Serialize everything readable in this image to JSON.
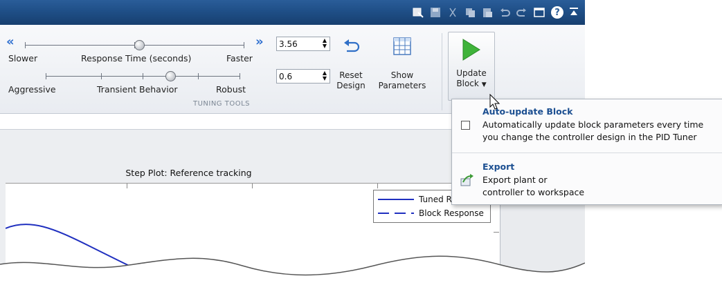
{
  "toolstrip": {
    "group_label": "TUNING TOOLS",
    "response_slider": {
      "left_label": "Slower",
      "center_label": "Response Time (seconds)",
      "right_label": "Faster",
      "value": "3.56"
    },
    "transient_slider": {
      "left_label": "Aggressive",
      "center_label": "Transient Behavior",
      "right_label": "Robust",
      "value": "0.6"
    },
    "reset": {
      "line1": "Reset",
      "line2": "Design"
    },
    "show": {
      "line1": "Show",
      "line2": "Parameters"
    },
    "update": {
      "line1": "Update",
      "line2": "Block"
    }
  },
  "quick_access": [
    "block-icon",
    "save-icon",
    "cut-icon",
    "copy-icon",
    "paste-icon",
    "undo-icon",
    "redo-icon",
    "window-icon",
    "help-icon",
    "collapse-icon"
  ],
  "plot": {
    "title": "Step Plot: Reference tracking",
    "legend": [
      {
        "label": "Tuned R",
        "style": "solid",
        "color": "#1f2fbf"
      },
      {
        "label": "Block Response",
        "style": "dashed",
        "color": "#1f2fbf"
      }
    ]
  },
  "menu": {
    "auto_update": {
      "title": "Auto-update Block",
      "desc_line1": "Automatically update block parameters every time",
      "desc_line2": "you  change the controller design in the PID Tuner",
      "checked": false
    },
    "export": {
      "title": "Export",
      "desc_line1": "Export plant or",
      "desc_line2": "controller to workspace"
    }
  },
  "colors": {
    "titlebar": "#1f4f87",
    "accent": "#1c4f91",
    "curve": "#1f2fbf",
    "play": "#3fb33a"
  }
}
